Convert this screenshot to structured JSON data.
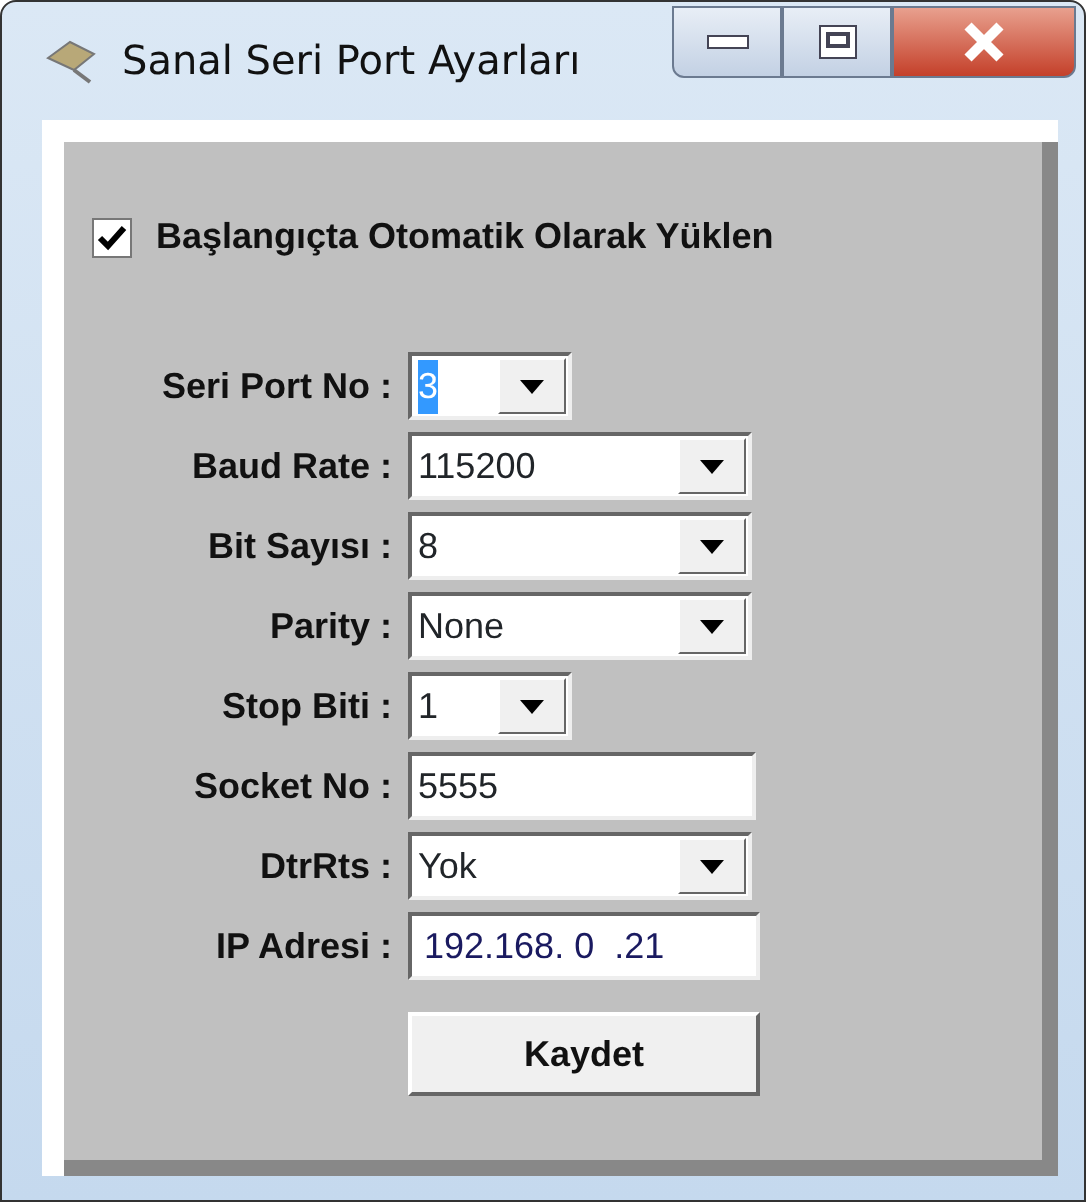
{
  "window": {
    "title": "Sanal Seri Port Ayarları"
  },
  "autostart": {
    "label": "Başlangıçta Otomatik Olarak Yüklen",
    "checked": true
  },
  "fields": [
    {
      "kind": "smallcombo",
      "label": "Seri Port No :",
      "value": "3",
      "highlighted": true
    },
    {
      "kind": "combo",
      "label": "Baud Rate :",
      "value": "115200",
      "highlighted": false
    },
    {
      "kind": "combo",
      "label": "Bit Sayısı :",
      "value": "8",
      "highlighted": false
    },
    {
      "kind": "combo",
      "label": "Parity :",
      "value": "None",
      "highlighted": false
    },
    {
      "kind": "smallcombo",
      "label": "Stop Biti :",
      "value": "1",
      "highlighted": false
    },
    {
      "kind": "text",
      "label": "Socket No :",
      "value": "5555",
      "highlighted": false
    },
    {
      "kind": "combo",
      "label": "DtrRts :",
      "value": "Yok",
      "highlighted": false
    },
    {
      "kind": "ip",
      "label": "IP Adresi :",
      "value": "192.168. 0  .21",
      "highlighted": false
    }
  ],
  "buttons": [
    "Kaydet"
  ]
}
